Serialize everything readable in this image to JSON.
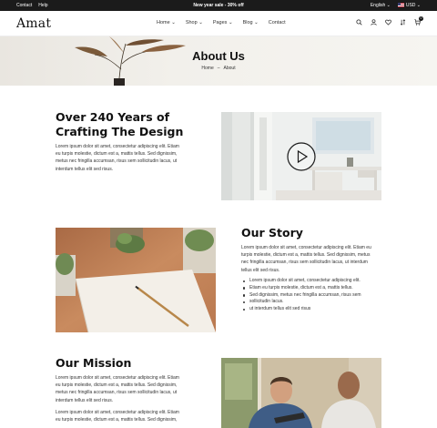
{
  "topbar": {
    "links": [
      "Contact",
      "Help"
    ],
    "promo": "New year sale - 30% off",
    "language": "English",
    "currency": "USD"
  },
  "header": {
    "logo": "Amat",
    "nav": [
      "Home",
      "Shop",
      "Pages",
      "Blog",
      "Contact"
    ],
    "cart_count": "0"
  },
  "hero": {
    "title": "About Us",
    "breadcrumb": [
      "Home",
      "About"
    ]
  },
  "crafting": {
    "title_line1": "Over 240 Years of",
    "title_line2": "Crafting The Design",
    "lines": [
      "Lorem ipsum dolor sit amet, consectetur adipiscing elit. Etiam",
      "eu turpis molestie, dictum est a, mattis tellus. Sed dignissim,",
      "metus nec fringilla accumsan, risus sem sollicitudin lacus, ut",
      "interdum tellus elit sed risus."
    ]
  },
  "story": {
    "title": "Our Story",
    "lines": [
      "Lorem ipsum dolor sit amet, consectetur adipiscing elit. Etiam eu",
      "turpis molestie, dictum est a, mattis tellus. Sed dignissim, metus",
      "nec fringilla accumsan, risus sem sollicitudin lacus, ut interdum",
      "tellus elit sed risus."
    ],
    "bullets": [
      "Lorem ipsum dolor sit amet, consectetur adipiscing elit.",
      "Etiam eu turpis molestie, dictum est a, mattis tellus.",
      "Sed dignissim, metus nec fringilla accumsan, risus sem",
      "sollicitudin lacus.",
      "ut interdum tellus elit sed risus"
    ]
  },
  "mission": {
    "title": "Our Mission",
    "lines": [
      "Lorem ipsum dolor sit amet, consectetur adipiscing elit. Etiam",
      "eu turpis molestie, dictum est a, mattis tellus. Sed dignissim,",
      "metus nec fringilla accumsan, risus sem sollicitudin lacus, ut",
      "interdum tellus elit sed risus."
    ],
    "lines2": [
      "Lorem ipsum dolor sit amet, consectetur adipiscing elit. Etiam",
      "eu turpis molestie, dictum est a, mattis tellus. Sed dignissim,"
    ]
  }
}
